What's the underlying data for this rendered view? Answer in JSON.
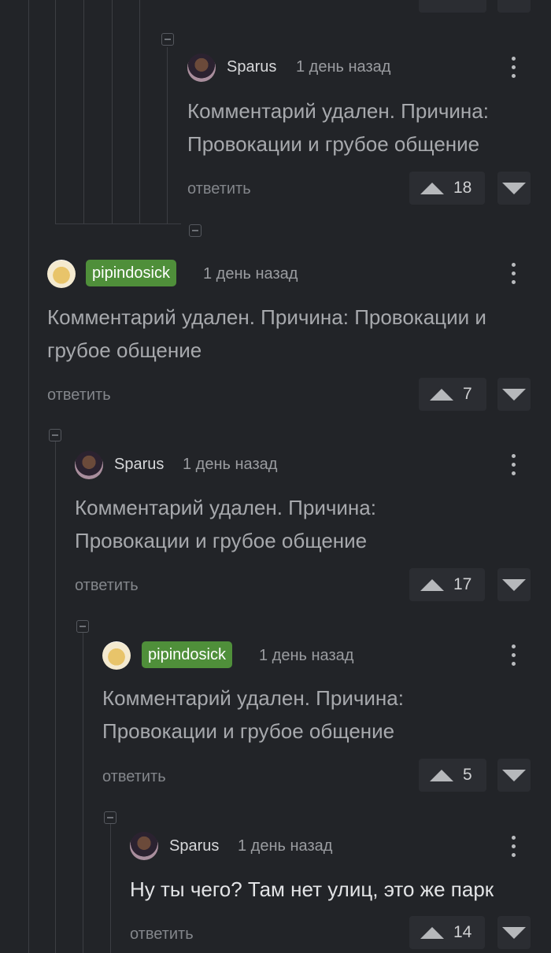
{
  "comments": [
    {
      "user": "Sparus",
      "time": "1 день назад",
      "text": "Комментарий удален. Причина: Провокации и грубое общение",
      "reply": "ответить",
      "votes": "18"
    },
    {
      "user": "pipindosick",
      "time": "1 день назад",
      "text": "Комментарий удален. Причина: Провокации и грубое общение",
      "reply": "ответить",
      "votes": "7"
    },
    {
      "user": "Sparus",
      "time": "1 день назад",
      "text": "Комментарий удален. Причина: Провокации и грубое общение",
      "reply": "ответить",
      "votes": "17"
    },
    {
      "user": "pipindosick",
      "time": "1 день назад",
      "text": "Комментарий удален. Причина: Провокации и грубое общение",
      "reply": "ответить",
      "votes": "5"
    },
    {
      "user": "Sparus",
      "time": "1 день назад",
      "text": "Ну ты чего? Там нет улиц, это же парк",
      "reply": "ответить",
      "votes": "14"
    }
  ],
  "icons": {
    "collapse": "minus-square-icon",
    "upvote": "triangle-up-icon",
    "downvote": "triangle-down-icon",
    "menu": "kebab-icon"
  },
  "colors": {
    "background": "#222428",
    "badge": "#4f8f3a",
    "thread_line": "#3c3e43"
  }
}
